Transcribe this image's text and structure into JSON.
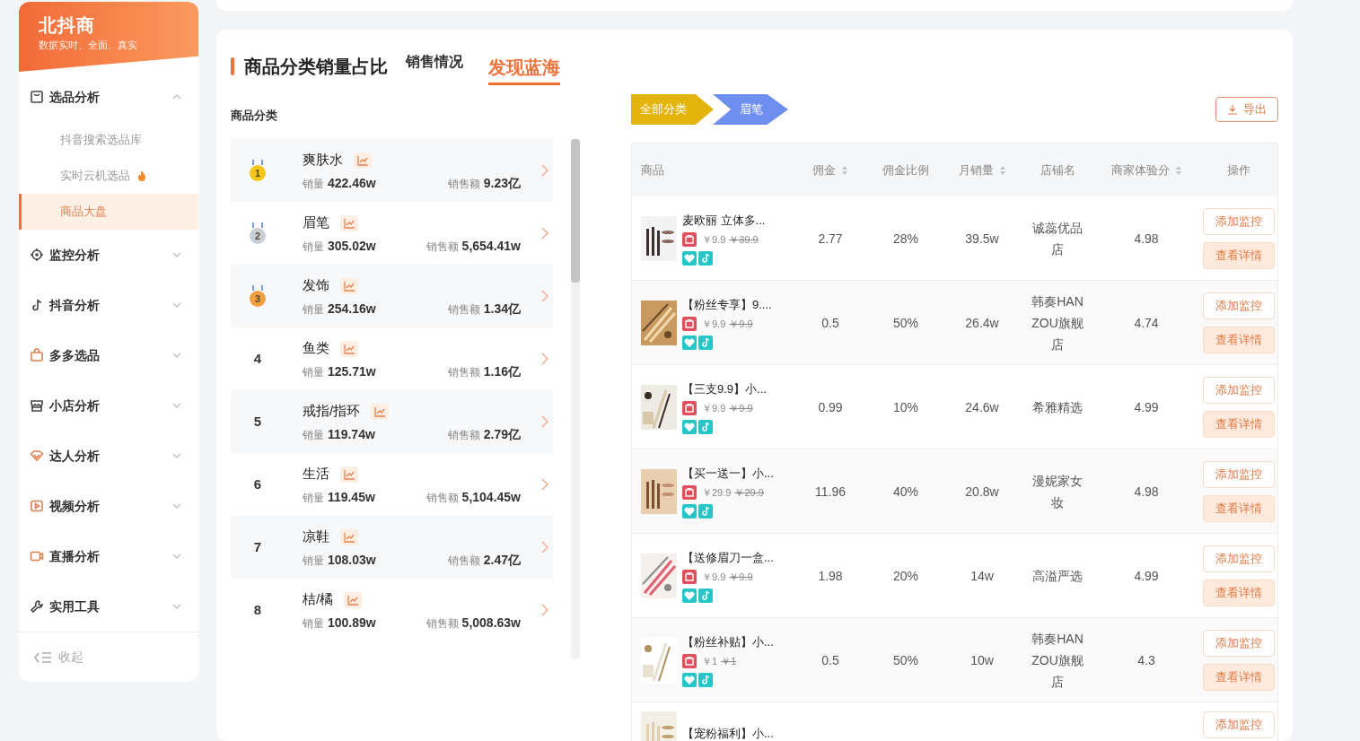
{
  "sidebar": {
    "brand": "北抖商",
    "tagline": "数据实时、全面、真实",
    "menu": [
      {
        "label": "选品分析",
        "expanded": true,
        "children": [
          {
            "label": "抖音搜索选品库",
            "selected": false,
            "hot": false
          },
          {
            "label": "实时云机选品",
            "selected": false,
            "hot": true
          },
          {
            "label": "商品大盘",
            "selected": true,
            "hot": false
          }
        ]
      },
      {
        "label": "监控分析",
        "expanded": false
      },
      {
        "label": "抖音分析",
        "expanded": false
      },
      {
        "label": "多多选品",
        "expanded": false
      },
      {
        "label": "小店分析",
        "expanded": false
      },
      {
        "label": "达人分析",
        "expanded": false
      },
      {
        "label": "视频分析",
        "expanded": false
      },
      {
        "label": "直播分析",
        "expanded": false
      },
      {
        "label": "实用工具",
        "expanded": false
      }
    ],
    "collapse": "收起"
  },
  "main": {
    "title": "商品分类销量占比",
    "tabs": [
      {
        "label": "销售情况",
        "selected": false
      },
      {
        "label": "发现蓝海",
        "selected": true
      }
    ],
    "category_label": "商品分类",
    "categories": [
      {
        "rank": "1",
        "kind": "medal",
        "color": "#f5c518",
        "name": "爽肤水",
        "sales_label": "销量",
        "sales": "422.46w",
        "revenue_label": "销售额",
        "revenue": "9.23亿"
      },
      {
        "rank": "2",
        "kind": "medal",
        "color": "#c9ced6",
        "name": "眉笔",
        "sales_label": "销量",
        "sales": "305.02w",
        "revenue_label": "销售额",
        "revenue": "5,654.41w"
      },
      {
        "rank": "3",
        "kind": "medal",
        "color": "#f0a040",
        "name": "发饰",
        "sales_label": "销量",
        "sales": "254.16w",
        "revenue_label": "销售额",
        "revenue": "1.34亿"
      },
      {
        "rank": "4",
        "kind": "plain",
        "name": "鱼类",
        "sales_label": "销量",
        "sales": "125.71w",
        "revenue_label": "销售额",
        "revenue": "1.16亿"
      },
      {
        "rank": "5",
        "kind": "plain",
        "name": "戒指/指环",
        "sales_label": "销量",
        "sales": "119.74w",
        "revenue_label": "销售额",
        "revenue": "2.79亿"
      },
      {
        "rank": "6",
        "kind": "plain",
        "name": "生活",
        "sales_label": "销量",
        "sales": "119.45w",
        "revenue_label": "销售额",
        "revenue": "5,104.45w"
      },
      {
        "rank": "7",
        "kind": "plain",
        "name": "凉鞋",
        "sales_label": "销量",
        "sales": "108.03w",
        "revenue_label": "销售额",
        "revenue": "2.47亿"
      },
      {
        "rank": "8",
        "kind": "plain",
        "name": "桔/橘",
        "sales_label": "销量",
        "sales": "100.89w",
        "revenue_label": "销售额",
        "revenue": "5,008.63w"
      }
    ],
    "breadcrumb": [
      {
        "label": "全部分类",
        "color": "#e3b50c"
      },
      {
        "label": "眉笔",
        "color": "#6f8ff0"
      }
    ],
    "export_button": "导出",
    "table": {
      "columns": [
        {
          "label": "商品",
          "sortable": false
        },
        {
          "label": "佣金",
          "sortable": true
        },
        {
          "label": "佣金比例",
          "sortable": false
        },
        {
          "label": "月销量",
          "sortable": true
        },
        {
          "label": "店铺名",
          "sortable": false
        },
        {
          "label": "商家体验分",
          "sortable": true
        },
        {
          "label": "操作",
          "sortable": false
        }
      ],
      "rows": [
        {
          "title": "麦欧丽 立体多...",
          "price": "￥9.9",
          "original_price": "￥39.9",
          "commission": "2.77",
          "rate": "28%",
          "monthly_sales": "39.5w",
          "shop": "诚蕊优品店",
          "score": "4.98",
          "actions": [
            "添加监控",
            "查看详情"
          ]
        },
        {
          "title": "【粉丝专享】9....",
          "price": "￥9.9",
          "original_price": "￥9.9",
          "commission": "0.5",
          "rate": "50%",
          "monthly_sales": "26.4w",
          "shop": "韩奏HANZOU旗舰店",
          "score": "4.74",
          "actions": [
            "添加监控",
            "查看详情"
          ]
        },
        {
          "title": "【三支9.9】小...",
          "price": "￥9.9",
          "original_price": "￥9.9",
          "commission": "0.99",
          "rate": "10%",
          "monthly_sales": "24.6w",
          "shop": "希雅精选",
          "score": "4.99",
          "actions": [
            "添加监控",
            "查看详情"
          ]
        },
        {
          "title": "【买一送一】小...",
          "price": "￥29.9",
          "original_price": "￥29.9",
          "commission": "11.96",
          "rate": "40%",
          "monthly_sales": "20.8w",
          "shop": "漫妮家女妆",
          "score": "4.98",
          "actions": [
            "添加监控",
            "查看详情"
          ]
        },
        {
          "title": "【送修眉刀一盒...",
          "price": "￥9.9",
          "original_price": "￥9.9",
          "commission": "1.98",
          "rate": "20%",
          "monthly_sales": "14w",
          "shop": "高溢严选",
          "score": "4.99",
          "actions": [
            "添加监控",
            "查看详情"
          ]
        },
        {
          "title": "【粉丝补贴】小...",
          "price": "￥1",
          "original_price": "￥1",
          "commission": "0.5",
          "rate": "50%",
          "monthly_sales": "10w",
          "shop": "韩奏HANZOU旗舰店",
          "score": "4.3",
          "actions": [
            "添加监控",
            "查看详情"
          ]
        },
        {
          "title": "【宠粉福利】小...",
          "actions": [
            "添加监控"
          ]
        }
      ]
    }
  }
}
